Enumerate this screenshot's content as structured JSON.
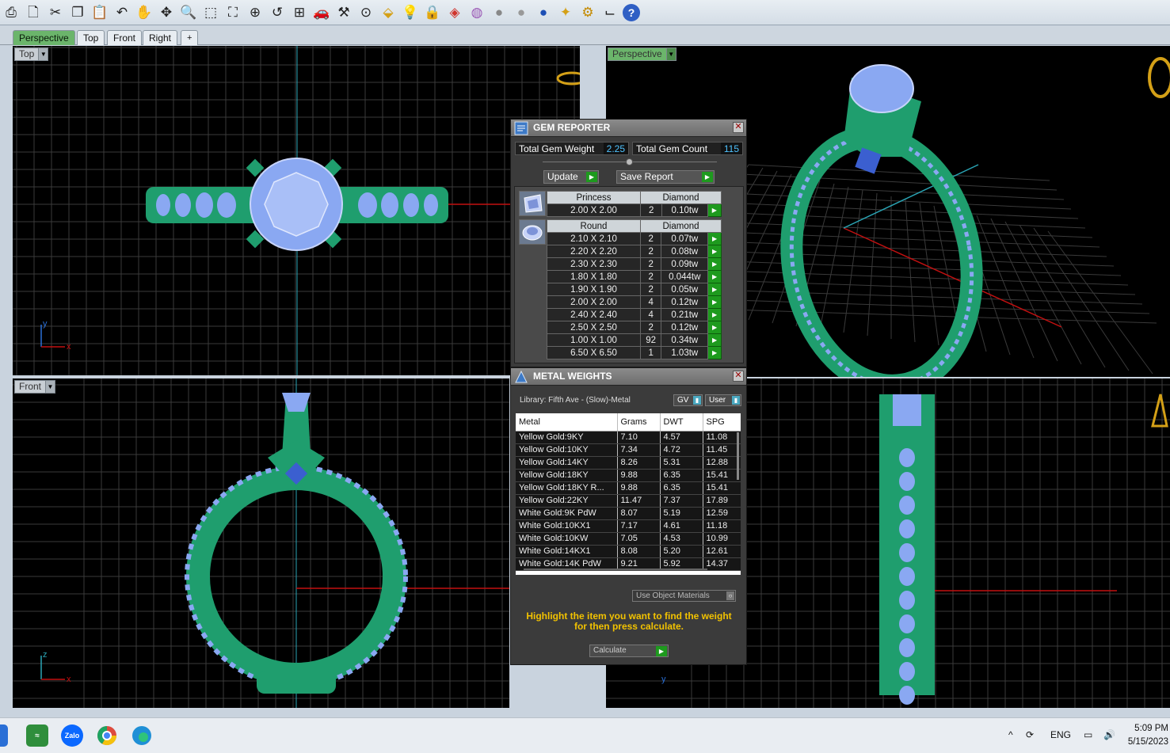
{
  "toolbar": {
    "icons": [
      "print-icon",
      "new-file-icon",
      "cut-icon",
      "copy-icon",
      "paste-icon",
      "undo-icon",
      "pan-hand-icon",
      "rotate-icon",
      "zoom-icon",
      "zoom-window-icon",
      "zoom-extents-icon",
      "zoom-selected-icon",
      "undo-view-icon",
      "grid-layout-icon",
      "car-icon",
      "tools-icon",
      "snap-icon",
      "object-snap-icon",
      "light-bulb-icon",
      "lock-icon",
      "layers-icon",
      "color-wheel-icon",
      "wireframe-sphere-icon",
      "shaded-sphere-icon",
      "rendered-sphere-icon",
      "spotlight-icon",
      "settings-gear-icon",
      "dimension-icon",
      "help-icon"
    ]
  },
  "tabs": [
    "Perspective",
    "Top",
    "Front",
    "Right",
    "+"
  ],
  "viewports": {
    "top": {
      "label": "Top"
    },
    "perspective": {
      "label": "Perspective"
    },
    "front": {
      "label": "Front"
    },
    "right": {
      "label": "Right"
    }
  },
  "axes": {
    "x": "x",
    "y": "y",
    "z": "z"
  },
  "gem_reporter": {
    "title": "GEM REPORTER",
    "total_gem_weight_label": "Total Gem Weight",
    "total_gem_weight": "2.25",
    "total_gem_count_label": "Total Gem Count",
    "total_gem_count": "115",
    "update_label": "Update",
    "save_report_label": "Save Report",
    "princess": {
      "cut": "Princess",
      "type": "Diamond",
      "rows": [
        {
          "size": "2.00 X 2.00",
          "count": "2",
          "weight": "0.10tw"
        }
      ]
    },
    "round": {
      "cut": "Round",
      "type": "Diamond",
      "rows": [
        {
          "size": "2.10 X 2.10",
          "count": "2",
          "weight": "0.07tw"
        },
        {
          "size": "2.20 X 2.20",
          "count": "2",
          "weight": "0.08tw"
        },
        {
          "size": "2.30 X 2.30",
          "count": "2",
          "weight": "0.09tw"
        },
        {
          "size": "1.80 X 1.80",
          "count": "2",
          "weight": "0.044tw"
        },
        {
          "size": "1.90 X 1.90",
          "count": "2",
          "weight": "0.05tw"
        },
        {
          "size": "2.00 X 2.00",
          "count": "4",
          "weight": "0.12tw"
        },
        {
          "size": "2.40 X 2.40",
          "count": "4",
          "weight": "0.21tw"
        },
        {
          "size": "2.50 X 2.50",
          "count": "2",
          "weight": "0.12tw"
        },
        {
          "size": "1.00 X 1.00",
          "count": "92",
          "weight": "0.34tw"
        },
        {
          "size": "6.50 X 6.50",
          "count": "1",
          "weight": "1.03tw"
        }
      ]
    }
  },
  "metal_weights": {
    "title": "METAL WEIGHTS",
    "library": "Library: Fifth Ave - (Slow)-Metal",
    "gv_label": "GV",
    "user_label": "User",
    "columns": [
      "Metal",
      "Grams",
      "DWT",
      "SPG"
    ],
    "rows": [
      [
        "Yellow Gold:9KY",
        "7.10",
        "4.57",
        "11.08"
      ],
      [
        "Yellow Gold:10KY",
        "7.34",
        "4.72",
        "11.45"
      ],
      [
        "Yellow Gold:14KY",
        "8.26",
        "5.31",
        "12.88"
      ],
      [
        "Yellow Gold:18KY",
        "9.88",
        "6.35",
        "15.41"
      ],
      [
        "Yellow Gold:18KY R...",
        "9.88",
        "6.35",
        "15.41"
      ],
      [
        "Yellow Gold:22KY",
        "11.47",
        "7.37",
        "17.89"
      ],
      [
        "White Gold:9K PdW",
        "8.07",
        "5.19",
        "12.59"
      ],
      [
        "White Gold:10KX1",
        "7.17",
        "4.61",
        "11.18"
      ],
      [
        "White Gold:10KW",
        "7.05",
        "4.53",
        "10.99"
      ],
      [
        "White Gold:14KX1",
        "8.08",
        "5.20",
        "12.61"
      ],
      [
        "White Gold:14K PdW",
        "9.21",
        "5.92",
        "14.37"
      ]
    ],
    "use_object_materials": "Use Object Materials",
    "hint": "Highlight the item you want to find the weight for then press calculate.",
    "calculate_label": "Calculate"
  },
  "taskbar": {
    "apps": [
      "start-icon",
      "app-green-icon",
      "zalo-icon",
      "chrome-icon",
      "edge-icon"
    ],
    "zalo_text": "Zalo",
    "language": "ENG",
    "time": "5:09 PM",
    "date": "5/15/2023"
  },
  "colors": {
    "metal": "#1f9e6e",
    "gem": "#8aa8f2",
    "grid": "#3a3a3a",
    "viewport_bg": "#000000",
    "panel_bg": "#3b3b3b",
    "hint_text": "#f2c200",
    "active_tab": "#6bb56b"
  }
}
